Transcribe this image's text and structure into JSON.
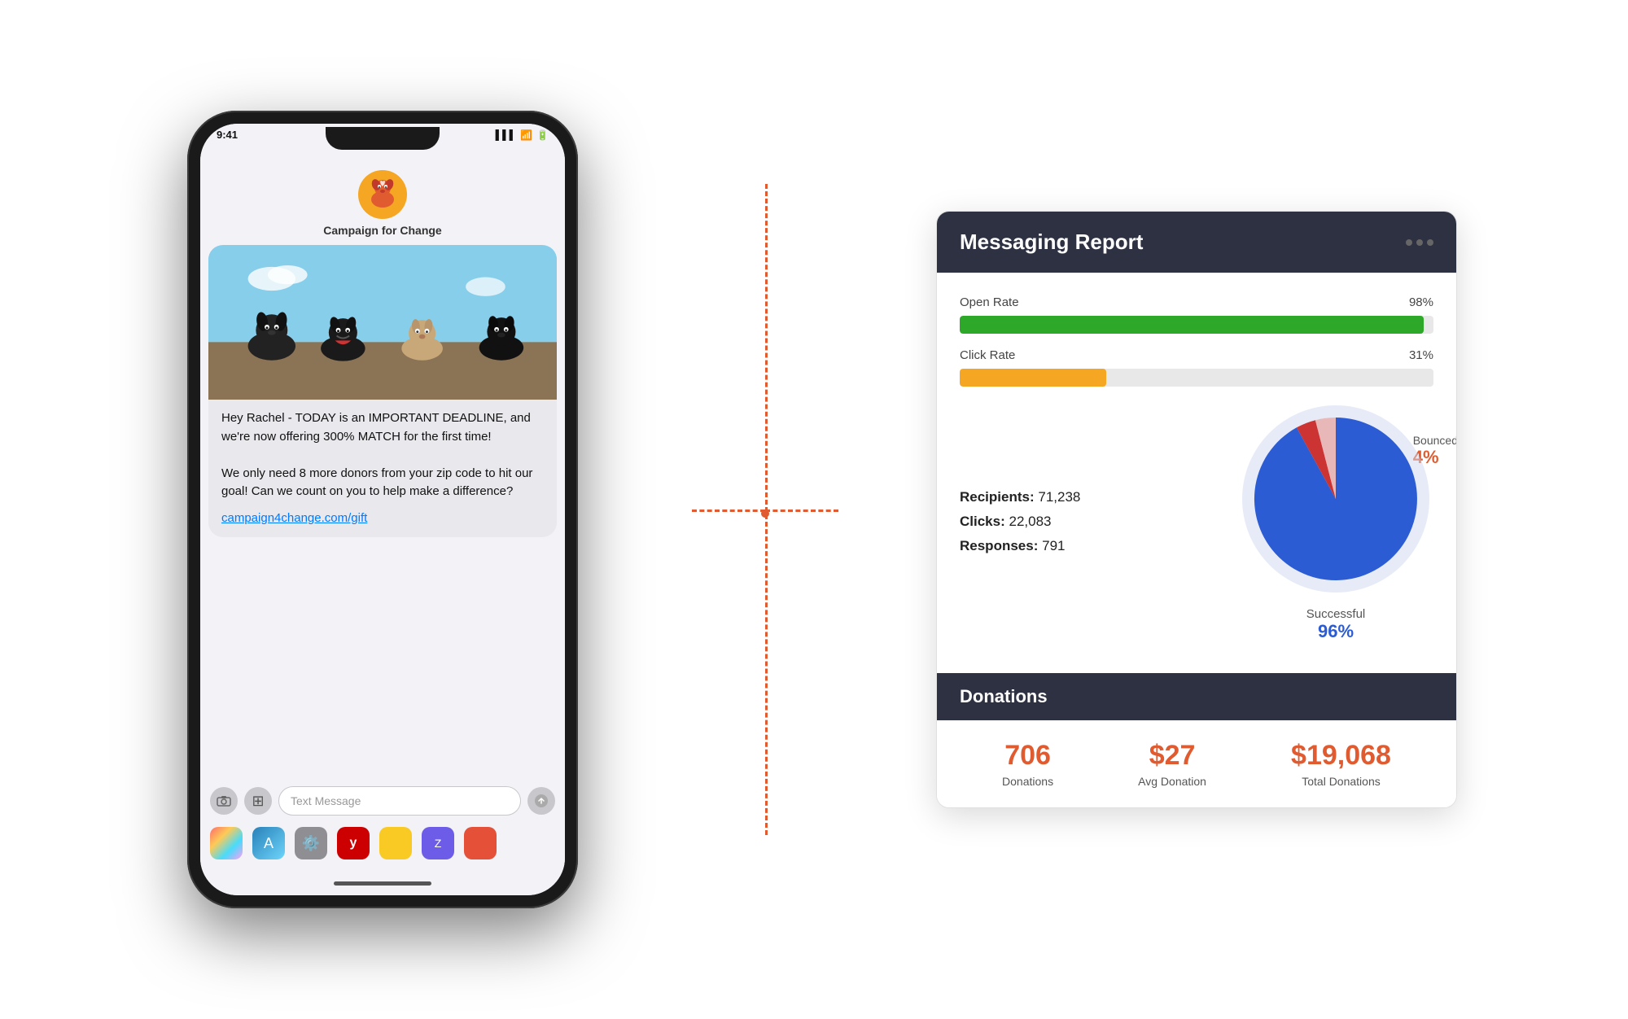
{
  "phone": {
    "status_time": "9:41",
    "app_name": "Campaign for Change",
    "message_text": "Hey Rachel - TODAY is an IMPORTANT DEADLINE, and we're now offering 300% MATCH for the first time!\n\nWe only need 8 more donors from your zip code to hit our goal! Can we count on you to help make a difference?",
    "message_link": "campaign4change.com/gift",
    "text_placeholder": "Text Message"
  },
  "report": {
    "title": "Messaging Report",
    "open_rate_label": "Open Rate",
    "open_rate_value": "98%",
    "open_rate_pct": 98,
    "click_rate_label": "Click Rate",
    "click_rate_value": "31%",
    "click_rate_pct": 31,
    "recipients_label": "Recipients:",
    "recipients_value": "71,238",
    "clicks_label": "Clicks:",
    "clicks_value": "22,083",
    "responses_label": "Responses:",
    "responses_value": "791",
    "successful_label": "Successful",
    "successful_pct": "96%",
    "bounced_label": "Bounced",
    "bounced_pct": "4%",
    "donations_title": "Donations",
    "donations_count": "706",
    "donations_count_label": "Donations",
    "avg_donation": "$27",
    "avg_donation_label": "Avg Donation",
    "total_donations": "$19,068",
    "total_donations_label": "Total Donations"
  }
}
